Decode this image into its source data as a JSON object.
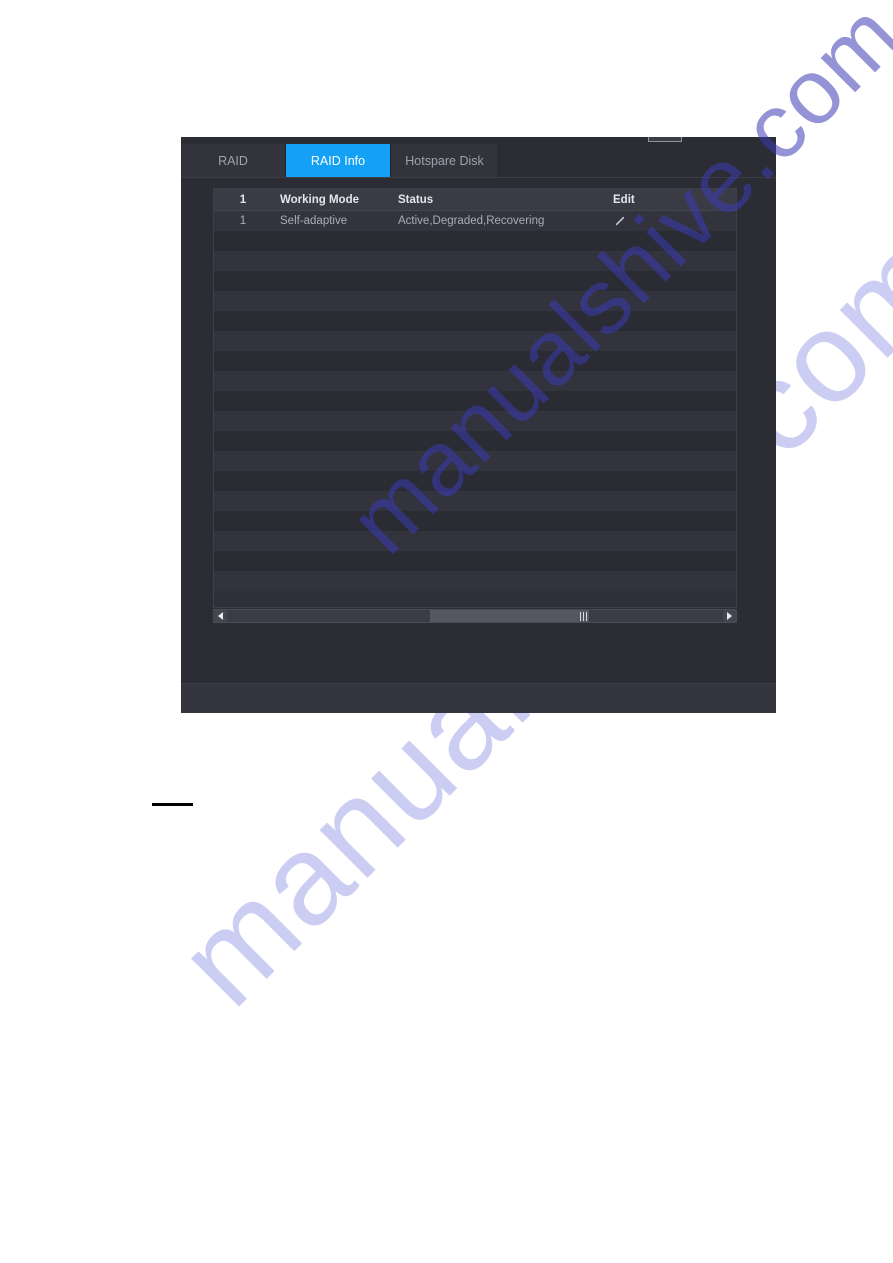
{
  "panel": {
    "title": "RAID Info",
    "accent_color": "#13a0f5",
    "background_color": "#2b2c34"
  },
  "tabs": [
    {
      "id": "raid",
      "label": "RAID",
      "active": false
    },
    {
      "id": "raid-info",
      "label": "RAID Info",
      "active": true
    },
    {
      "id": "hotspare-disk",
      "label": "Hotspare Disk",
      "active": false
    }
  ],
  "table": {
    "columns": [
      "1",
      "Working Mode",
      "Status",
      "Edit"
    ],
    "rows": [
      {
        "index": "1",
        "working_mode": "Self-adaptive",
        "status": "Active,Degraded,Recovering",
        "edit_icon": "pencil-icon"
      }
    ],
    "empty_row_count": 18
  },
  "scrollbar": {
    "orientation": "horizontal",
    "left_arrow_icon": "triangle-left-icon",
    "right_arrow_icon": "triangle-right-icon",
    "thumb_position_pct": 41,
    "thumb_width_pct": 32
  },
  "watermarks": {
    "small": "manualshive.com",
    "large": "manualshive.com"
  }
}
